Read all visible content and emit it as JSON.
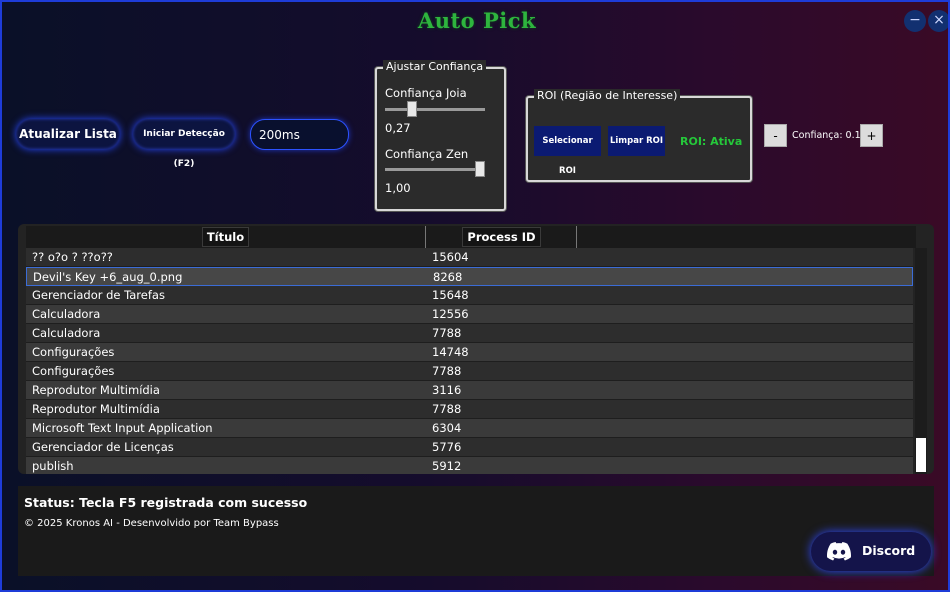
{
  "window": {
    "title": "Auto Pick",
    "minimize_glyph": "−",
    "close_glyph": "×"
  },
  "toolbar": {
    "refresh_label": "Atualizar Lista",
    "start_label": "Iniciar Detecção (F2)",
    "interval_value": "200ms"
  },
  "confidence": {
    "legend": "Ajustar Confiança",
    "jewel_label": "Confiança Joia",
    "jewel_value": "0,27",
    "jewel_level": 0.27,
    "zen_label": "Confiança Zen",
    "zen_value": "1,00",
    "zen_level": 1.0
  },
  "roi": {
    "legend": "ROI (Região de Interesse)",
    "select_label": "Selecionar ROI",
    "clear_label": "Limpar ROI",
    "status": "ROI: Ativa"
  },
  "roi_confidence": {
    "minus_label": "-",
    "readout": "Confiança: 0.1",
    "plus_label": "+"
  },
  "process_list": {
    "columns": [
      "Título",
      "Process ID"
    ],
    "selected_index": 1,
    "rows": [
      {
        "title": "?? o?o ?  ??o??",
        "pid": "15604"
      },
      {
        "title": "Devil's Key +6_aug_0.png",
        "pid": "8268"
      },
      {
        "title": "Gerenciador de Tarefas",
        "pid": "15648"
      },
      {
        "title": "Calculadora",
        "pid": "12556"
      },
      {
        "title": "Calculadora",
        "pid": "7788"
      },
      {
        "title": "Configurações",
        "pid": "14748"
      },
      {
        "title": "Configurações",
        "pid": "7788"
      },
      {
        "title": "Reprodutor Multimídia",
        "pid": "3116"
      },
      {
        "title": "Reprodutor Multimídia",
        "pid": "7788"
      },
      {
        "title": "Microsoft Text Input Application",
        "pid": "6304"
      },
      {
        "title": "Gerenciador de Licenças",
        "pid": "5776"
      },
      {
        "title": "publish",
        "pid": "5912"
      }
    ]
  },
  "status": {
    "text": "Status: Tecla F5 registrada com sucesso",
    "footer": "© 2025 Kronos AI - Desenvolvido por Team Bypass"
  },
  "discord": {
    "label": "Discord",
    "icon": "discord-icon"
  },
  "colors": {
    "accent_blue": "#2748ff",
    "title_green": "#2eb53e",
    "roi_active_green": "#25c83a"
  }
}
